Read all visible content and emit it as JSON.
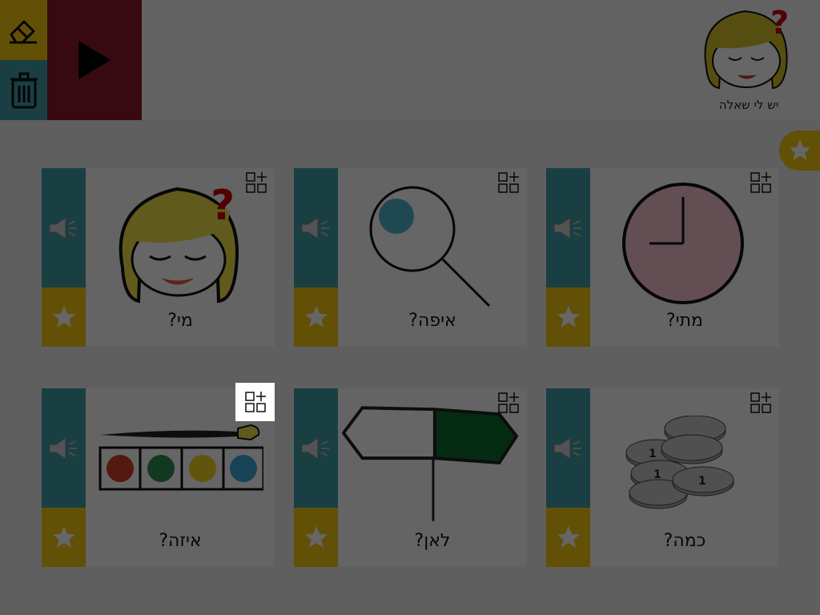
{
  "header": {
    "title_label": "יש לי שאלה",
    "buttons": [
      {
        "name": "eraser-icon"
      },
      {
        "name": "trash-icon"
      },
      {
        "name": "play-icon"
      }
    ]
  },
  "favorites_tab": {
    "icon": "star-icon"
  },
  "cards": [
    {
      "label": "מי?",
      "picto": "girl-question-face"
    },
    {
      "label": "איפה?",
      "picto": "magnifying-glass"
    },
    {
      "label": "מתי?",
      "picto": "clock"
    },
    {
      "label": "איזה?",
      "picto": "paint-palette"
    },
    {
      "label": "לאן?",
      "picto": "direction-sign"
    },
    {
      "label": "כמה?",
      "picto": "coins"
    }
  ],
  "colors": {
    "yellow": "#f2c811",
    "teal": "#3f9fa9",
    "dark_red": "#8b1a2b",
    "overlay": "rgba(0,0,0,0.6)"
  }
}
